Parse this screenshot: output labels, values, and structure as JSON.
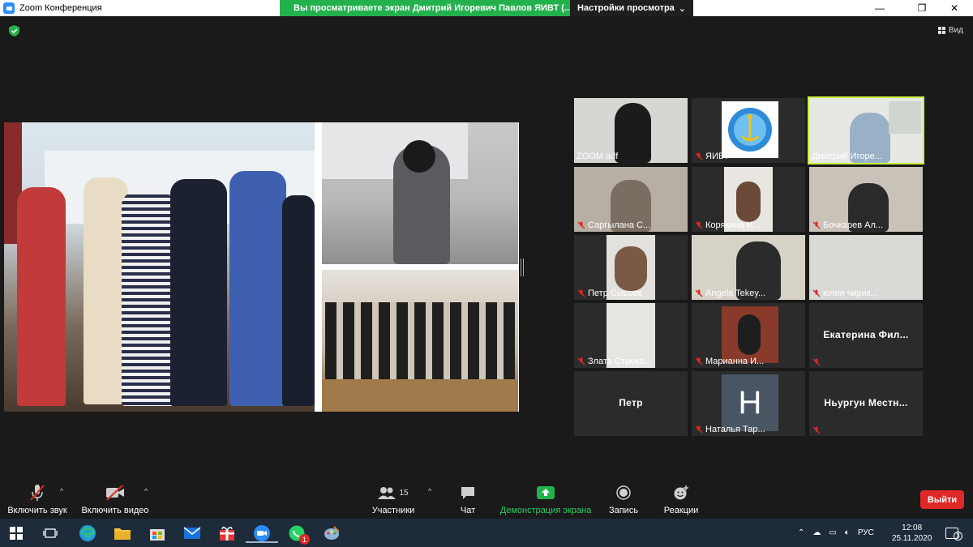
{
  "window": {
    "title": "Zoom Конференция",
    "share_banner": "Вы просматриваете экран Дмитрий Игоревич Павлов ЯИВТ (...",
    "view_settings": "Настройки просмотра",
    "minimize": "—",
    "maximize": "❐",
    "close": "✕"
  },
  "meeting": {
    "view_label": "Вид"
  },
  "participants": [
    {
      "name": "ZOOM adf",
      "muted": false
    },
    {
      "name": "ЯИВТ",
      "muted": true
    },
    {
      "name": "Дмитрий Игоре...",
      "muted": false
    },
    {
      "name": "Саргылана С...",
      "muted": true
    },
    {
      "name": "Корякина И...",
      "muted": true
    },
    {
      "name": "Бочкарев Ал...",
      "muted": true
    },
    {
      "name": "Петр Сысоев",
      "muted": true
    },
    {
      "name": "Angela Tekey...",
      "muted": true
    },
    {
      "name": "юлия чирик...",
      "muted": true
    },
    {
      "name": "Злата Стрека...",
      "muted": true
    },
    {
      "name": "Марианна И...",
      "muted": true
    },
    {
      "name": "Екатерина  Фил...",
      "muted": true
    },
    {
      "name": "Петр",
      "muted": false
    },
    {
      "name": "Наталья Тар...",
      "muted": true,
      "avatar_letter": "H"
    },
    {
      "name": "Ньургун  Местн...",
      "muted": true
    }
  ],
  "toolbar": {
    "unmute": "Включить звук",
    "start_video": "Включить видео",
    "participants_label": "Участники",
    "participants_count": "15",
    "chat": "Чат",
    "share_screen": "Демонстрация экрана",
    "record": "Запись",
    "reactions": "Реакции",
    "leave": "Выйти"
  },
  "taskbar": {
    "language": "РУС",
    "time": "12:08",
    "date": "25.11.2020",
    "notifications": "3",
    "whatsapp_badge": "1"
  },
  "colors": {
    "accent_green": "#23b14d",
    "leave_red": "#e02828",
    "active_speaker": "#c8f03c"
  }
}
